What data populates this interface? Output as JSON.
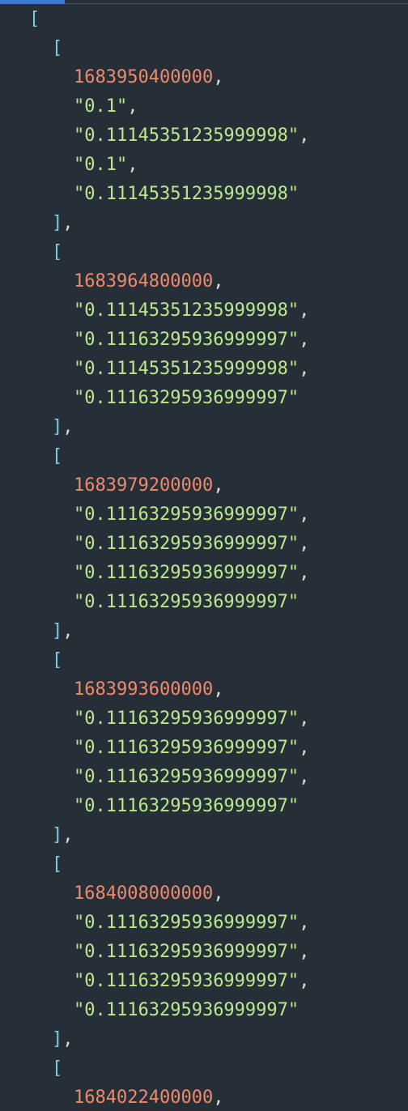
{
  "editor": {
    "open_bracket": "[",
    "close_bracket": "]",
    "comma": ",",
    "quote": "\"",
    "rows": [
      {
        "timestamp": "1683950400000",
        "values": [
          "0.1",
          "0.11145351235999998",
          "0.1",
          "0.11145351235999998"
        ]
      },
      {
        "timestamp": "1683964800000",
        "values": [
          "0.11145351235999998",
          "0.11163295936999997",
          "0.11145351235999998",
          "0.11163295936999997"
        ]
      },
      {
        "timestamp": "1683979200000",
        "values": [
          "0.11163295936999997",
          "0.11163295936999997",
          "0.11163295936999997",
          "0.11163295936999997"
        ]
      },
      {
        "timestamp": "1683993600000",
        "values": [
          "0.11163295936999997",
          "0.11163295936999997",
          "0.11163295936999997",
          "0.11163295936999997"
        ]
      },
      {
        "timestamp": "1684008000000",
        "values": [
          "0.11163295936999997",
          "0.11163295936999997",
          "0.11163295936999997",
          "0.11163295936999997"
        ]
      },
      {
        "timestamp": "1684022400000",
        "values": []
      }
    ]
  },
  "colors": {
    "background": "#262f37",
    "bracket": "#7fcbe5",
    "number": "#f0886c",
    "string": "#b9e88d",
    "tab_indicator": "#3d7cc9"
  }
}
